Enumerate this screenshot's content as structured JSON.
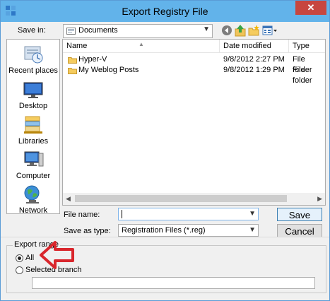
{
  "window": {
    "title": "Export Registry File",
    "close_glyph": "✕"
  },
  "toolbar": {
    "save_in_label": "Save in:",
    "save_in_value": "Documents",
    "icons": [
      "back-icon",
      "up-folder-icon",
      "new-folder-icon",
      "view-menu-icon"
    ]
  },
  "places": [
    {
      "label": "Recent places",
      "icon": "recent-places-icon"
    },
    {
      "label": "Desktop",
      "icon": "desktop-icon"
    },
    {
      "label": "Libraries",
      "icon": "libraries-icon"
    },
    {
      "label": "Computer",
      "icon": "computer-icon"
    },
    {
      "label": "Network",
      "icon": "network-icon"
    }
  ],
  "file_list": {
    "columns": [
      "Name",
      "Date modified",
      "Type"
    ],
    "rows": [
      {
        "name": "Hyper-V",
        "date": "9/8/2012 2:27 PM",
        "type": "File folder"
      },
      {
        "name": "My Weblog Posts",
        "date": "9/8/2012 1:29 PM",
        "type": "File folder"
      }
    ]
  },
  "form": {
    "file_name_label": "File name:",
    "file_name_value": "",
    "save_as_label": "Save as type:",
    "save_as_value": "Registration Files (*.reg)",
    "save_button": "Save",
    "cancel_button": "Cancel"
  },
  "export_range": {
    "title": "Export range",
    "option_all": "All",
    "option_selected": "Selected branch",
    "selected": "All",
    "branch_value": ""
  },
  "colors": {
    "titlebar": "#62b3ea",
    "close_button": "#c7463f",
    "annotation_arrow": "#d9262c"
  }
}
